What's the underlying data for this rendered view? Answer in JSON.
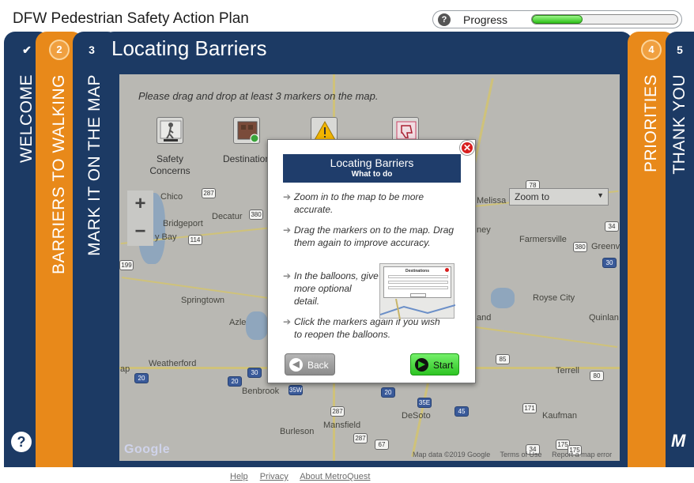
{
  "app": {
    "title": "DFW Pedestrian Safety Action Plan"
  },
  "progress": {
    "label": "Progress",
    "help_glyph": "?",
    "value_fraction": 0.35,
    "fill_color": "#2fc21a"
  },
  "panels": {
    "welcome": {
      "number": "✔",
      "label": "WELCOME"
    },
    "barriers": {
      "number": "2",
      "label": "BARRIERS TO WALKING"
    },
    "mark": {
      "number": "3",
      "label": "MARK IT ON THE MAP"
    },
    "priorities": {
      "number": "4",
      "label": "PRIORITIES"
    },
    "thanks": {
      "number": "5",
      "label": "THANK YOU"
    }
  },
  "colors": {
    "navy": "#1c3a64",
    "orange": "#e8891a"
  },
  "main": {
    "title": "Locating Barriers"
  },
  "map": {
    "instruction": "Please drag and drop at least 3 markers on the map.",
    "markers": [
      {
        "label1": "Safety",
        "label2": "Concerns",
        "icon": "pedestrian-icon"
      },
      {
        "label1": "Destination",
        "label2": "",
        "icon": "destination-icon"
      },
      {
        "label1": "",
        "label2": "",
        "icon": "warning-icon"
      },
      {
        "label1": "",
        "label2": "",
        "icon": "thumbs-down-icon"
      }
    ],
    "zoom_in": "+",
    "zoom_out": "−",
    "zoom_select": "Zoom to",
    "google": "Google",
    "footer": {
      "data": "Map data ©2019 Google",
      "terms": "Terms of Use",
      "report": "Report a map error"
    },
    "towns": [
      {
        "name": "Chico"
      },
      {
        "name": "Decatur"
      },
      {
        "name": "Bridgeport"
      },
      {
        "name": "y Bay"
      },
      {
        "name": "Springtown"
      },
      {
        "name": "Azle"
      },
      {
        "name": "Weatherford"
      },
      {
        "name": "Benbrook"
      },
      {
        "name": "Burleson"
      },
      {
        "name": "Mansfield"
      },
      {
        "name": "DeSoto"
      },
      {
        "name": "Kaufman"
      },
      {
        "name": "Terrell"
      },
      {
        "name": "Royse City"
      },
      {
        "name": "Quinlan"
      },
      {
        "name": "Farmersville"
      },
      {
        "name": "Greenv"
      },
      {
        "name": "Melissa"
      },
      {
        "name": "ney"
      },
      {
        "name": "and"
      },
      {
        "name": "ap"
      }
    ],
    "shields": [
      "287",
      "380",
      "114",
      "199",
      "30",
      "20",
      "35W",
      "287",
      "20",
      "20",
      "35E",
      "45",
      "287",
      "67",
      "85",
      "80",
      "171",
      "175",
      "34",
      "175",
      "78",
      "34",
      "380",
      "30"
    ]
  },
  "modal": {
    "close_glyph": "✕",
    "title": "Locating Barriers",
    "subtitle": "What to do",
    "steps": [
      "Zoom in to the map to be more accurate.",
      "Drag the markers on to the map. Drag them again to improve accuracy.",
      "In the balloons, give more optional detail.",
      "Click the markers again if you wish to reopen the balloons."
    ],
    "thumb_title": "Destinations",
    "back_label": "Back",
    "start_label": "Start"
  },
  "footer": {
    "links": [
      "Help",
      "Privacy",
      "About MetroQuest"
    ]
  }
}
